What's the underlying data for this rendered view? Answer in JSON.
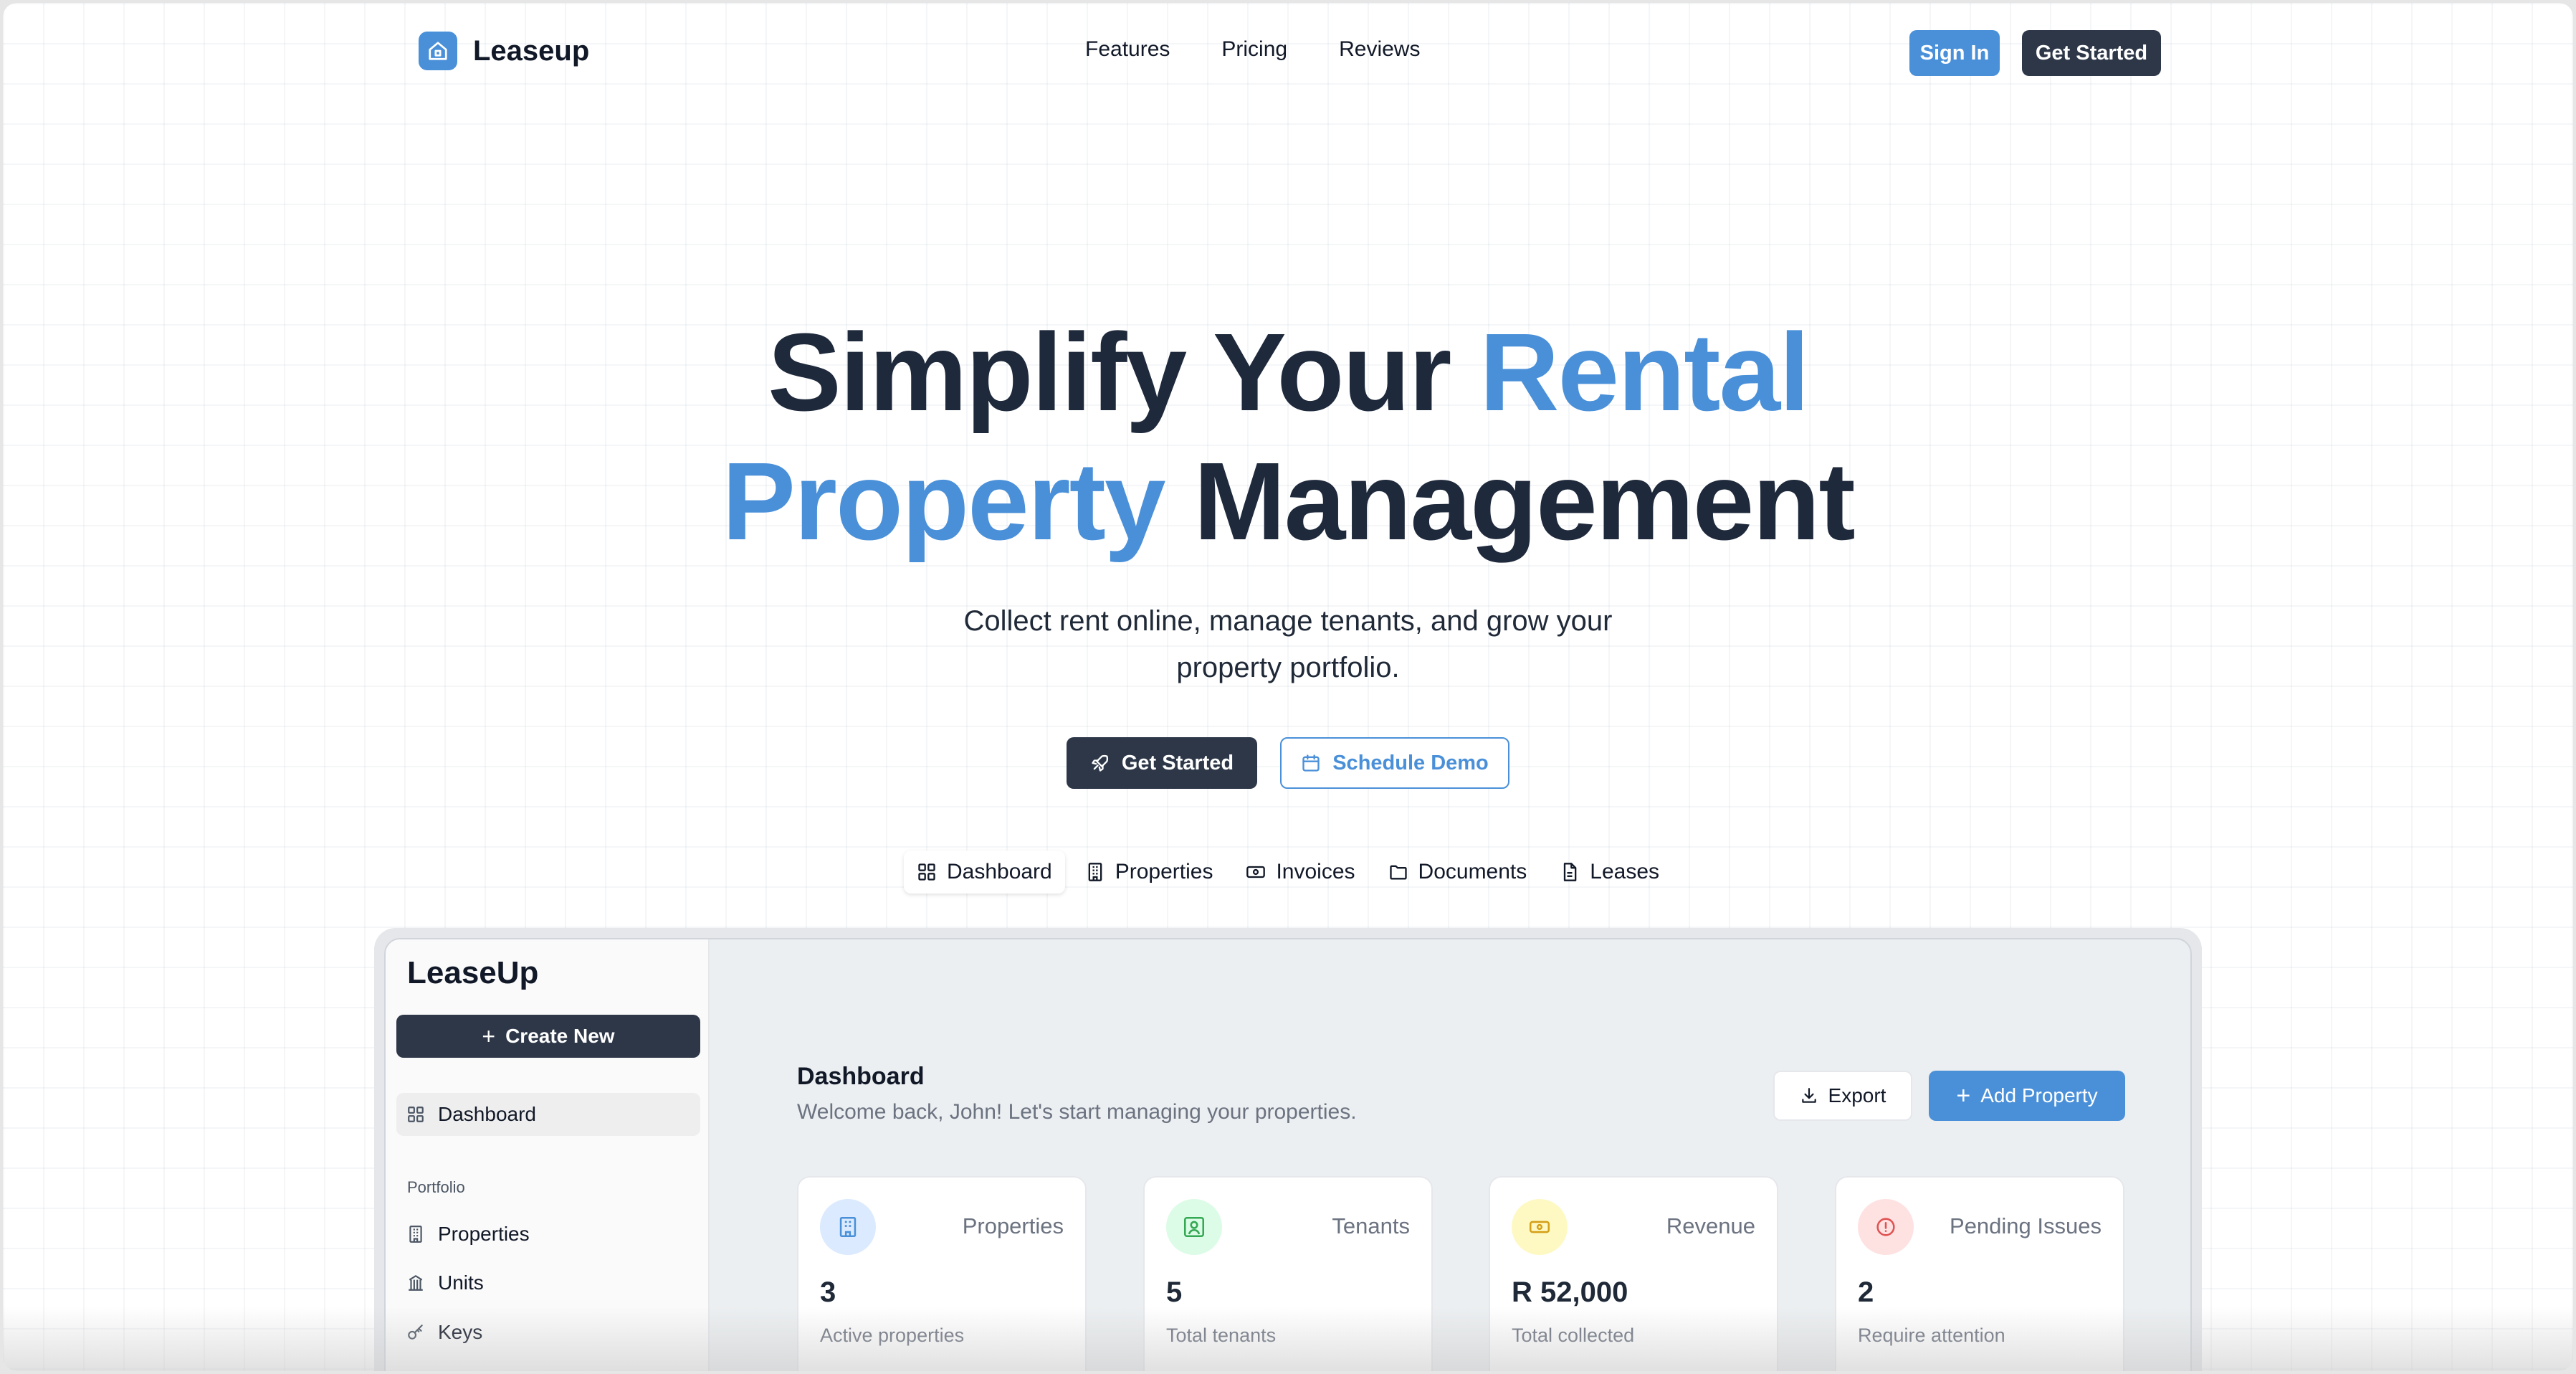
{
  "nav": {
    "brand": "Leaseup",
    "links": [
      "Features",
      "Pricing",
      "Reviews"
    ],
    "sign_in": "Sign In",
    "get_started": "Get Started"
  },
  "hero": {
    "title_part1": "Simplify Your ",
    "title_part2": "Rental",
    "title_part3": "Property",
    "title_part4": " Management",
    "subtitle_line1": "Collect rent online, manage tenants, and grow your",
    "subtitle_line2": "property portfolio.",
    "cta_primary": "Get Started",
    "cta_secondary": "Schedule Demo"
  },
  "tabs": [
    {
      "label": "Dashboard",
      "icon": "grid-icon"
    },
    {
      "label": "Properties",
      "icon": "building-icon"
    },
    {
      "label": "Invoices",
      "icon": "money-icon"
    },
    {
      "label": "Documents",
      "icon": "folder-icon"
    },
    {
      "label": "Leases",
      "icon": "file-icon"
    }
  ],
  "app": {
    "title": "LeaseUp",
    "create_new": "Create New",
    "sidebar": {
      "dashboard": "Dashboard",
      "section_portfolio": "Portfolio",
      "properties": "Properties",
      "units": "Units",
      "keys": "Keys"
    },
    "header": {
      "title": "Dashboard",
      "subtitle": "Welcome back, John! Let's start managing your properties.",
      "export": "Export",
      "add_property": "Add Property"
    },
    "cards": [
      {
        "label": "Properties",
        "value": "3",
        "caption": "Active properties",
        "icon": "building-icon",
        "tint": "#dbeafe",
        "icon_color": "#4a90d9"
      },
      {
        "label": "Tenants",
        "value": "5",
        "caption": "Total tenants",
        "icon": "user-icon",
        "tint": "#dcfce7",
        "icon_color": "#34a853"
      },
      {
        "label": "Revenue",
        "value": "R 52,000",
        "caption": "Total collected",
        "icon": "money-icon",
        "tint": "#fef9c3",
        "icon_color": "#d4a017"
      },
      {
        "label": "Pending Issues",
        "value": "2",
        "caption": "Require attention",
        "icon": "alert-icon",
        "tint": "#fee2e2",
        "icon_color": "#e05252"
      }
    ]
  },
  "colors": {
    "accent": "#4a90d9",
    "dark": "#2d3748",
    "heading": "#1e293b"
  }
}
